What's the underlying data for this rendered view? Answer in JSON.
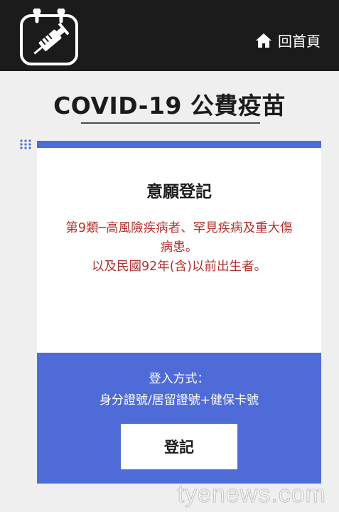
{
  "header": {
    "logo_icon": "calendar-syringe-icon",
    "home_icon": "home-icon",
    "home_label": "回首頁"
  },
  "page_title": "COVID-19 公費疫苗",
  "card": {
    "heading": "意願登記",
    "description_lines": [
      "第9類─高風險疾病者、罕見疾病及重大傷",
      "病患。",
      "以及民國92年(含)以前出生者。"
    ],
    "login_label": "登入方式：",
    "login_method": "身分證號/居留證號+健保卡號",
    "register_button": "登記"
  },
  "watermark": "tyenews.com",
  "colors": {
    "header_bg": "#1b1b1b",
    "page_bg": "#efefef",
    "accent_blue": "#4f6bd8",
    "description_red": "#b3322d"
  }
}
